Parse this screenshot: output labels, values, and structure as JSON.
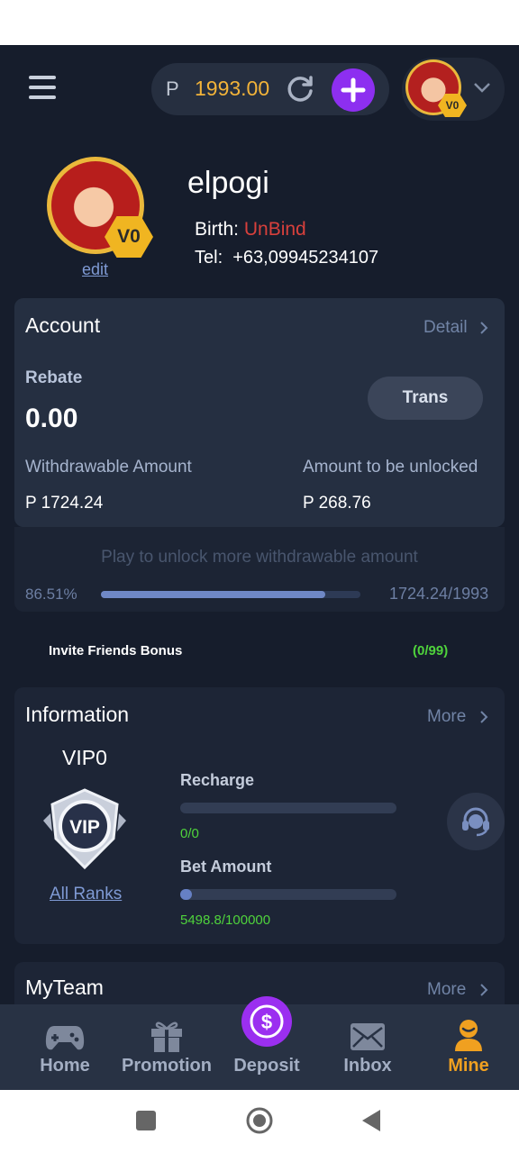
{
  "header": {
    "currency": "P",
    "balance": "1993.00",
    "vip_badge": "V0"
  },
  "profile": {
    "username": "elpogi",
    "vip_badge": "V0",
    "edit_label": "edit",
    "birth_label": "Birth:",
    "birth_value": "UnBind",
    "tel_label": "Tel:",
    "tel_value": "+63,09945234107"
  },
  "account": {
    "title": "Account",
    "detail_label": "Detail",
    "rebate_label": "Rebate",
    "rebate_value": "0.00",
    "trans_label": "Trans",
    "withdrawable_label": "Withdrawable Amount",
    "withdrawable_value": "P 1724.24",
    "unlock_label": "Amount to be unlocked",
    "unlock_value": "P 268.76",
    "unlock_hint": "Play to unlock more withdrawable amount",
    "progress_percent": "86.51%",
    "progress_fraction": 0.8651,
    "progress_text": "1724.24/1993"
  },
  "invite": {
    "label": "Invite Friends Bonus",
    "count": "(0/99)"
  },
  "information": {
    "title": "Information",
    "more_label": "More",
    "vip_level": "VIP0",
    "vip_badge_text": "VIP",
    "all_ranks_label": "All Ranks",
    "recharge_label": "Recharge",
    "recharge_value": "0/0",
    "recharge_fraction": 0,
    "bet_label": "Bet Amount",
    "bet_value": "5498.8/100000",
    "bet_fraction": 0.055
  },
  "team": {
    "title": "MyTeam",
    "more_label": "More"
  },
  "nav": {
    "home": "Home",
    "promotion": "Promotion",
    "deposit": "Deposit",
    "inbox": "Inbox",
    "mine": "Mine",
    "active_color": "#f0a020",
    "deposit_color": "#9b2ff0"
  }
}
